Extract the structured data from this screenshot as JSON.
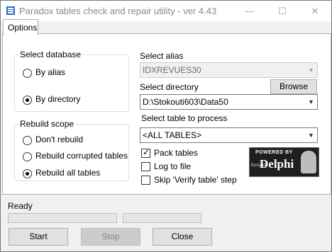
{
  "window": {
    "title": "Paradox tables check and repair utility - ver 4.43"
  },
  "tabs": [
    {
      "label": "Options"
    }
  ],
  "select_database": {
    "legend": "Select database",
    "options": [
      {
        "label": "By alias",
        "selected": false
      },
      {
        "label": "By directory",
        "selected": true
      }
    ]
  },
  "rebuild_scope": {
    "legend": "Rebuild scope",
    "options": [
      {
        "label": "Don't rebuild",
        "selected": false
      },
      {
        "label": "Rebuild corrupted tables",
        "selected": false
      },
      {
        "label": "Rebuild all tables",
        "selected": true
      }
    ]
  },
  "alias": {
    "label": "Select alias",
    "value": "IDXREVUES30",
    "enabled": false
  },
  "directory": {
    "label": "Select directory",
    "value": "D:\\Stokouti603\\Data50",
    "browse_label": "Browse"
  },
  "table": {
    "label": "Select table to process",
    "value": "<ALL TABLES>"
  },
  "checkboxes": [
    {
      "label": "Pack tables",
      "checked": true
    },
    {
      "label": "Log to file",
      "checked": false
    },
    {
      "label": "Skip 'Verify table' step",
      "checked": false
    }
  ],
  "badge": {
    "powered_by": "POWERED BY",
    "brand": "Delphi",
    "vendor": "Borland"
  },
  "status": {
    "text": "Ready"
  },
  "buttons": {
    "start": "Start",
    "stop": "Stop",
    "close": "Close"
  },
  "colors": {
    "window_bg": "#f0f0f0",
    "panel_bg": "#ffffff",
    "disabled_text": "#838383"
  }
}
